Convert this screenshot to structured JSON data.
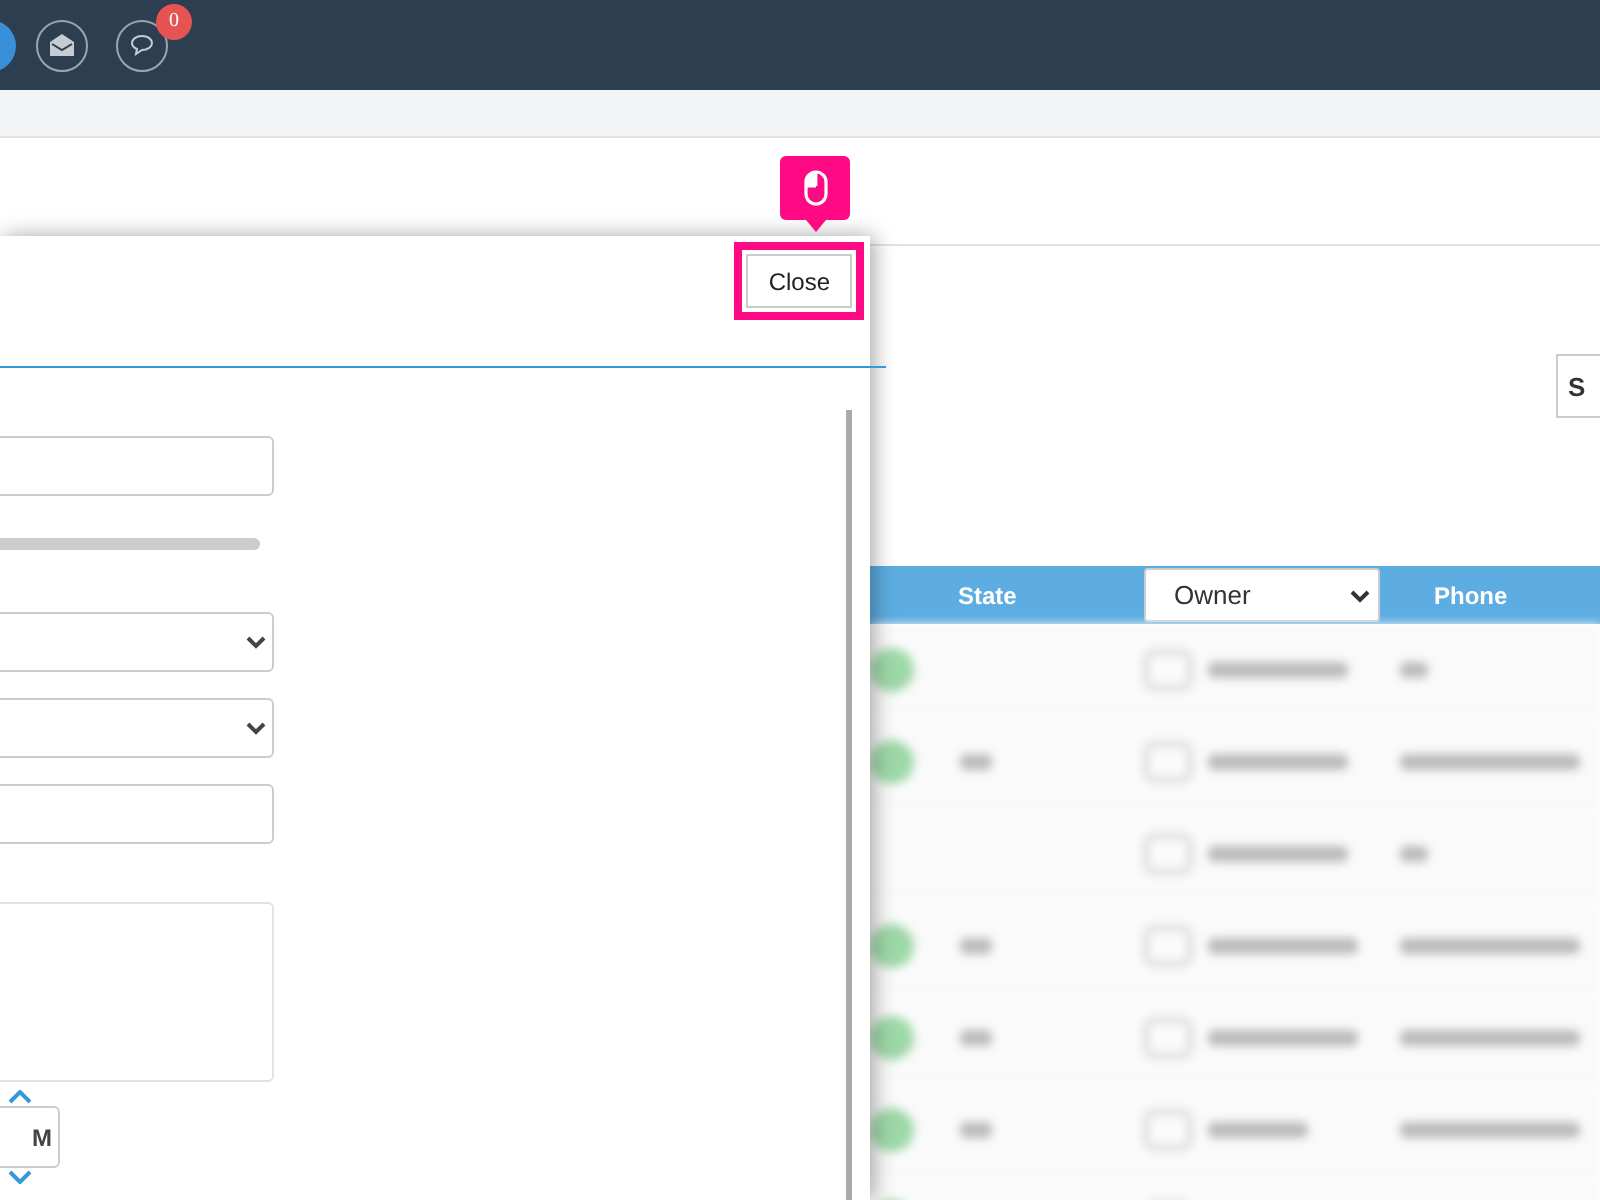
{
  "navbar": {
    "badge_count": "0"
  },
  "modal": {
    "close_button": "Close",
    "close_highlighted": true,
    "fields": [
      {
        "kind": "input"
      },
      {
        "kind": "bar"
      },
      {
        "kind": "select"
      },
      {
        "kind": "select"
      },
      {
        "kind": "input"
      },
      {
        "kind": "textarea"
      },
      {
        "kind": "time",
        "value": "M"
      }
    ]
  },
  "toolbar_button": "S",
  "table": {
    "columns": [
      {
        "kind": "label",
        "label": "State"
      },
      {
        "kind": "select",
        "label": "Owner"
      },
      {
        "kind": "label",
        "label": "Phone"
      }
    ],
    "rows": [
      {
        "online": true
      },
      {
        "online": true
      },
      {
        "online": false
      },
      {
        "online": true
      },
      {
        "online": true
      },
      {
        "online": true
      },
      {
        "online": true
      }
    ]
  }
}
